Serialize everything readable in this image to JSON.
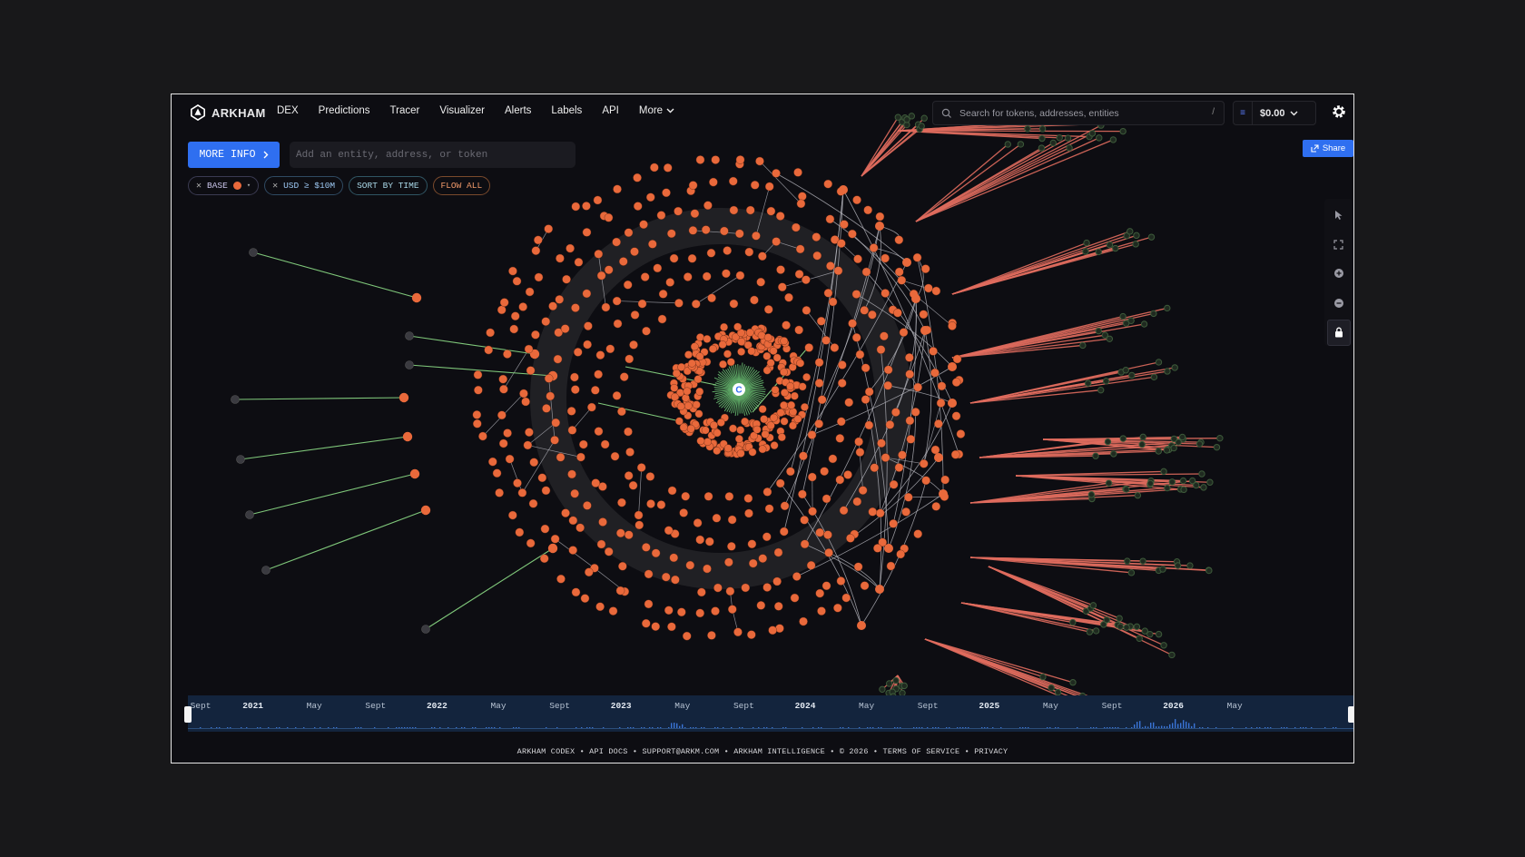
{
  "app": {
    "brand": "ARKHAM"
  },
  "nav": {
    "items": [
      "DEX",
      "Predictions",
      "Tracer",
      "Visualizer",
      "Alerts",
      "Labels",
      "API"
    ],
    "more_label": "More"
  },
  "search": {
    "placeholder": "Search for tokens, addresses, entities",
    "shortcut": "/"
  },
  "wallet": {
    "balance": "$0.00",
    "coin_icon": "list-icon"
  },
  "controls": {
    "more_info_label": "MORE INFO",
    "entity_placeholder": "Add an entity, address, or token",
    "chips": [
      {
        "label": "BASE",
        "kind": "base"
      },
      {
        "label": "USD ≥ $10M",
        "kind": "usd"
      },
      {
        "label": "SORT BY TIME",
        "kind": "sort"
      },
      {
        "label": "FLOW ALL",
        "kind": "flow"
      }
    ],
    "share_label": "Share"
  },
  "graph": {
    "center_label": "C",
    "colors": {
      "orange_node": "#e9693b",
      "green_edge": "#7fc77a",
      "red_edge": "#e06c5e",
      "gray_edge": "#b5b5bd",
      "dark_node": "#3a3a40",
      "green_hub": "#5ea865",
      "center": "#ffffff"
    }
  },
  "timeline": {
    "labels": [
      "Sept",
      "2021",
      "May",
      "Sept",
      "2022",
      "May",
      "Sept",
      "2023",
      "May",
      "Sept",
      "2024",
      "May",
      "Sept",
      "2025",
      "May",
      "Sept",
      "2026",
      "May"
    ]
  },
  "footer": {
    "text": "ARKHAM CODEX • API DOCS • SUPPORT@ARKM.COM • ARKHAM INTELLIGENCE • © 2026 • TERMS OF SERVICE • PRIVACY"
  }
}
